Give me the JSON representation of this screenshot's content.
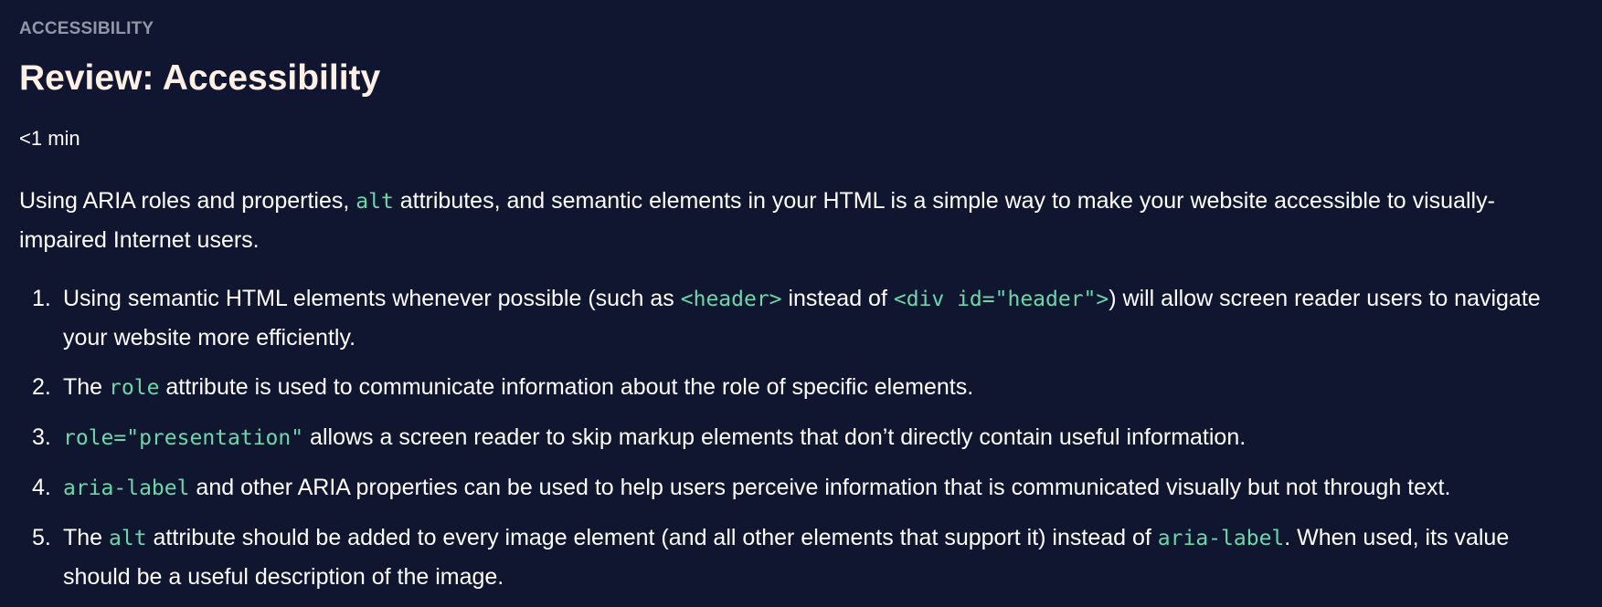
{
  "header": {
    "eyebrow": "ACCESSIBILITY",
    "title": "Review: Accessibility",
    "read_time": "<1 min"
  },
  "intro": {
    "t1": "Using ARIA roles and properties, ",
    "c1": "alt",
    "t2": " attributes, and semantic elements in your HTML is a simple way to make your website accessible to visually-impaired Internet users."
  },
  "list": [
    {
      "num": "1.",
      "t1": "Using semantic HTML elements whenever possible (such as ",
      "c1": "<header>",
      "t2": " instead of ",
      "c2": "<div id=\"header\">",
      "t3": ") will allow screen reader users to navigate your website more efficiently."
    },
    {
      "num": "2.",
      "t1": "The ",
      "c1": "role",
      "t2": " attribute is used to communicate information about the role of specific elements."
    },
    {
      "num": "3.",
      "c1": "role=\"presentation\"",
      "t1": " allows a screen reader to skip markup elements that don’t directly contain useful information."
    },
    {
      "num": "4.",
      "c1": "aria-label",
      "t1": " and other ARIA properties can be used to help users perceive information that is communicated visually but not through text."
    },
    {
      "num": "5.",
      "t1": "The ",
      "c1": "alt",
      "t2": " attribute should be added to every image element (and all other elements that support it) instead of ",
      "c2": "aria-label",
      "t3": ". When used, its value should be a useful description of the image."
    }
  ],
  "colors": {
    "background": "#10162f",
    "code": "#6bd8a9",
    "title": "#fff0e5",
    "eyebrow": "#9197a9"
  }
}
